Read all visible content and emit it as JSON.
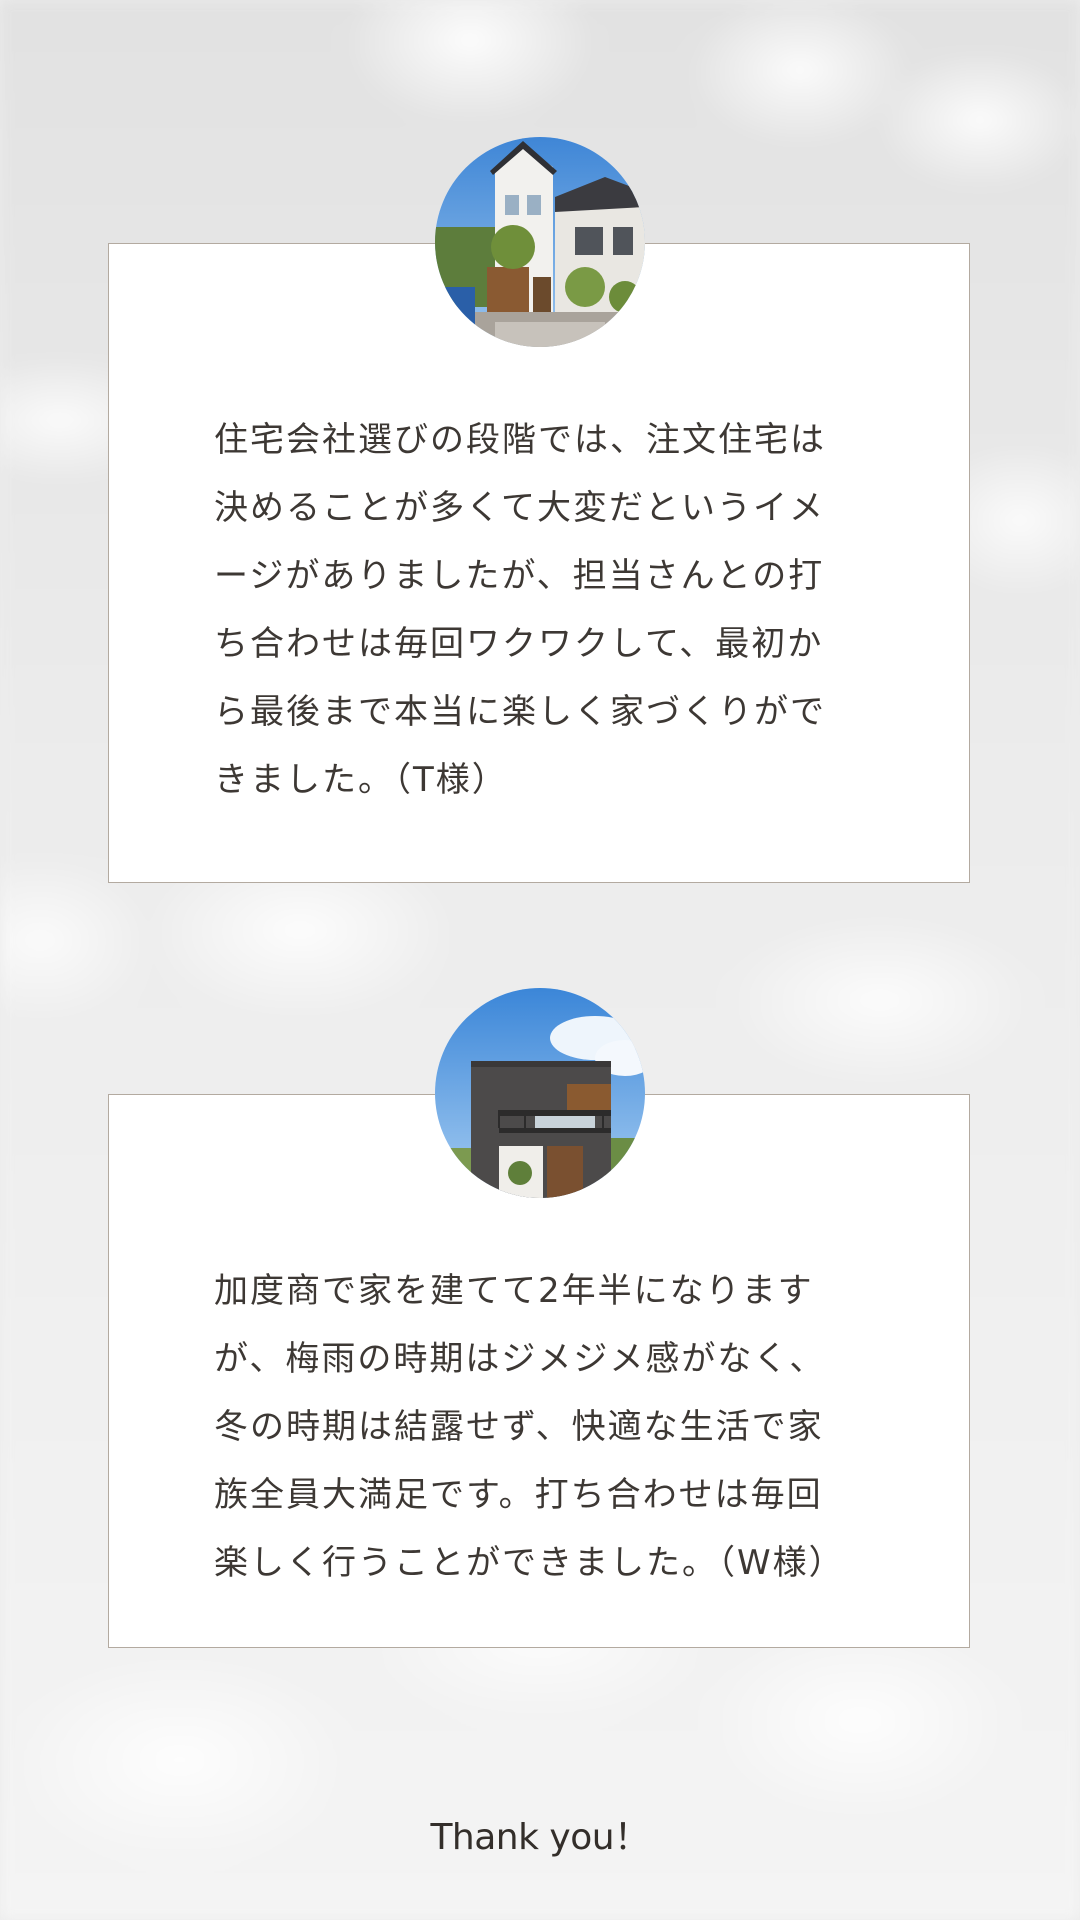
{
  "reviews": [
    {
      "photo_icon": "house-photo-white-gabled",
      "text": "住宅会社選びの段階では、注文住宅は\n決めることが多くて大変だというイメ\nージがありましたが、担当さんとの打\nち合わせは毎回ワクワクして、最初か\nら最後まで本当に楽しく家づくりがで\nきました。（T様）"
    },
    {
      "photo_icon": "house-photo-dark-modern",
      "text": "加度商で家を建てて2年半になります\nが、梅雨の時期はジメジメ感がなく、\n冬の時期は結露せず、快適な生活で家\n族全員大満足です。打ち合わせは毎回\n楽しく行うことができました。（W様）"
    }
  ],
  "footer": {
    "thank_you": "Thank you！"
  },
  "colors": {
    "text": "#3d3834",
    "card_border": "#b3aaa0",
    "card_background": "#ffffff",
    "page_background": "#ececec"
  }
}
